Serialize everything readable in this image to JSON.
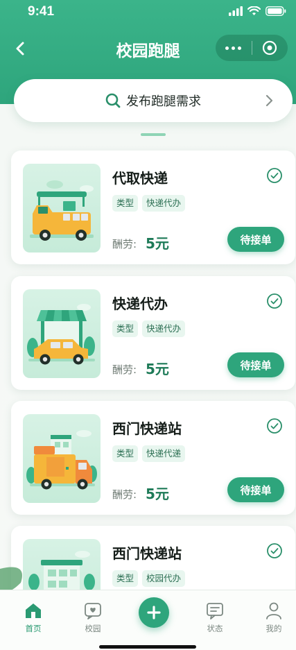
{
  "status_bar": {
    "time": "9:41"
  },
  "nav": {
    "title": "校园跑腿"
  },
  "search": {
    "label": "发布跑腿需求"
  },
  "tasks": [
    {
      "title": "代取快递",
      "tag_type": "类型",
      "tag_value": "快递代办",
      "fee_label": "酬劳:",
      "fee": "5元",
      "status": "待接单",
      "illustration": "truck-icon"
    },
    {
      "title": "快递代办",
      "tag_type": "类型",
      "tag_value": "快递代办",
      "fee_label": "酬劳:",
      "fee": "5元",
      "status": "待接单",
      "illustration": "shop-car-icon"
    },
    {
      "title": "西门快递站",
      "tag_type": "类型",
      "tag_value": "快递代递",
      "fee_label": "酬劳:",
      "fee": "5元",
      "status": "待接单",
      "illustration": "delivery-truck-icon"
    },
    {
      "title": "西门快递站",
      "tag_type": "类型",
      "tag_value": "校园代办",
      "fee_label": "",
      "fee": "",
      "status": "",
      "illustration": "building-icon"
    }
  ],
  "tab_bar": {
    "items": [
      {
        "label": "首页",
        "icon": "home-icon",
        "active": true
      },
      {
        "label": "校园",
        "icon": "heart-message-icon",
        "active": false
      },
      {
        "label": "",
        "icon": "plus-icon",
        "active": false
      },
      {
        "label": "状态",
        "icon": "chat-icon",
        "active": false
      },
      {
        "label": "我的",
        "icon": "user-icon",
        "active": false
      }
    ]
  },
  "colors": {
    "primary": "#2ea57c",
    "header": "#3bb48a",
    "accent_text": "#1d7a57"
  }
}
